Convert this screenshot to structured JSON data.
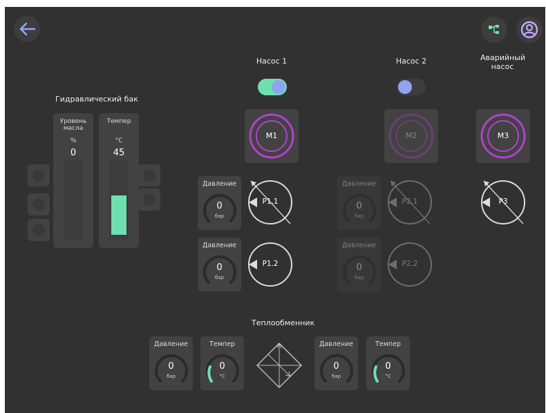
{
  "header": {
    "back_icon": "arrow-left-icon",
    "tree_icon": "hierarchy-icon",
    "user_icon": "user-circle-icon"
  },
  "pumps": [
    {
      "title": "Насос 1",
      "toggle_on": true,
      "motor": "M1",
      "motor_active": true
    },
    {
      "title": "Насос 2",
      "toggle_on": false,
      "motor": "M2",
      "motor_active": false
    },
    {
      "title": "Аварийный насос",
      "motor": "M3",
      "motor_active": true
    }
  ],
  "tank": {
    "title": "Гидравлический бак",
    "level": {
      "title": "Уровень масла",
      "unit": "%",
      "value": "0",
      "fill_fraction": 0
    },
    "temp": {
      "title": "Темпер",
      "unit": "°C",
      "value": "45",
      "fill_fraction": 0.56
    }
  },
  "pressure_gauges": {
    "p11": {
      "title": "Давление",
      "value": "0",
      "unit": "бар"
    },
    "p12": {
      "title": "Давление",
      "value": "0",
      "unit": "бар"
    },
    "p21": {
      "title": "Давление",
      "value": "0",
      "unit": "бар"
    },
    "p22": {
      "title": "Давление",
      "value": "0",
      "unit": "бар"
    }
  },
  "sensors": {
    "p11": "P1.1",
    "p12": "P1.2",
    "p21": "P2.1",
    "p22": "P2.2",
    "p3": "P3"
  },
  "heat_exchanger": {
    "title": "Теплообменник",
    "left_pressure": {
      "title": "Давление",
      "value": "0",
      "unit": "бар"
    },
    "left_temp": {
      "title": "Темпер",
      "value": "0",
      "unit": "°C"
    },
    "right_pressure": {
      "title": "Давление",
      "value": "0",
      "unit": "бар"
    },
    "right_temp": {
      "title": "Темпер",
      "value": "0",
      "unit": "°C"
    }
  },
  "colors": {
    "background": "#313131",
    "card": "#424242",
    "accent_green": "#6ee0b0",
    "motor_purple": "#b33fd0",
    "toggle_knob": "#8fa3f0",
    "user_icon": "#c8a8ff"
  }
}
